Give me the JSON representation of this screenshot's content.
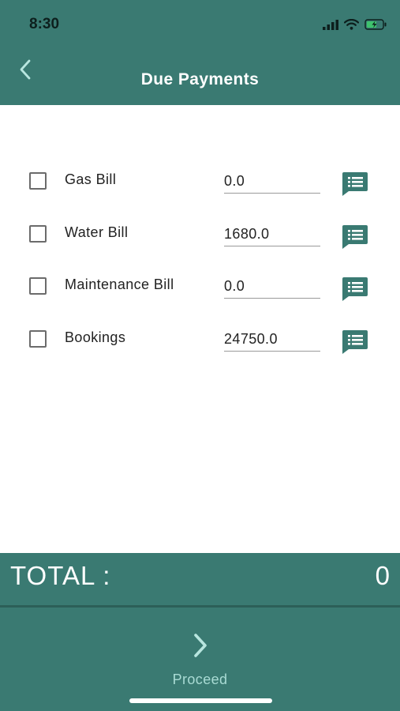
{
  "status_bar": {
    "time": "8:30",
    "icons": [
      "cellular-signal-icon",
      "wifi-icon",
      "battery-charging-icon"
    ]
  },
  "header": {
    "title": "Due Payments",
    "back_icon": "chevron-left-icon"
  },
  "bills": [
    {
      "label": "Gas Bill",
      "amount": "0.0",
      "checked": false
    },
    {
      "label": "Water Bill",
      "amount": "1680.0",
      "checked": false
    },
    {
      "label": "Maintenance Bill",
      "amount": "0.0",
      "checked": false
    },
    {
      "label": "Bookings",
      "amount": "24750.0",
      "checked": false
    }
  ],
  "total": {
    "label": "TOTAL :",
    "value": "0"
  },
  "footer": {
    "proceed_label": "Proceed",
    "proceed_icon": "chevron-right-icon"
  },
  "colors": {
    "primary": "#3a7a72",
    "primary_dark": "#2c5f58",
    "proceed_text": "#a9dbd4"
  }
}
